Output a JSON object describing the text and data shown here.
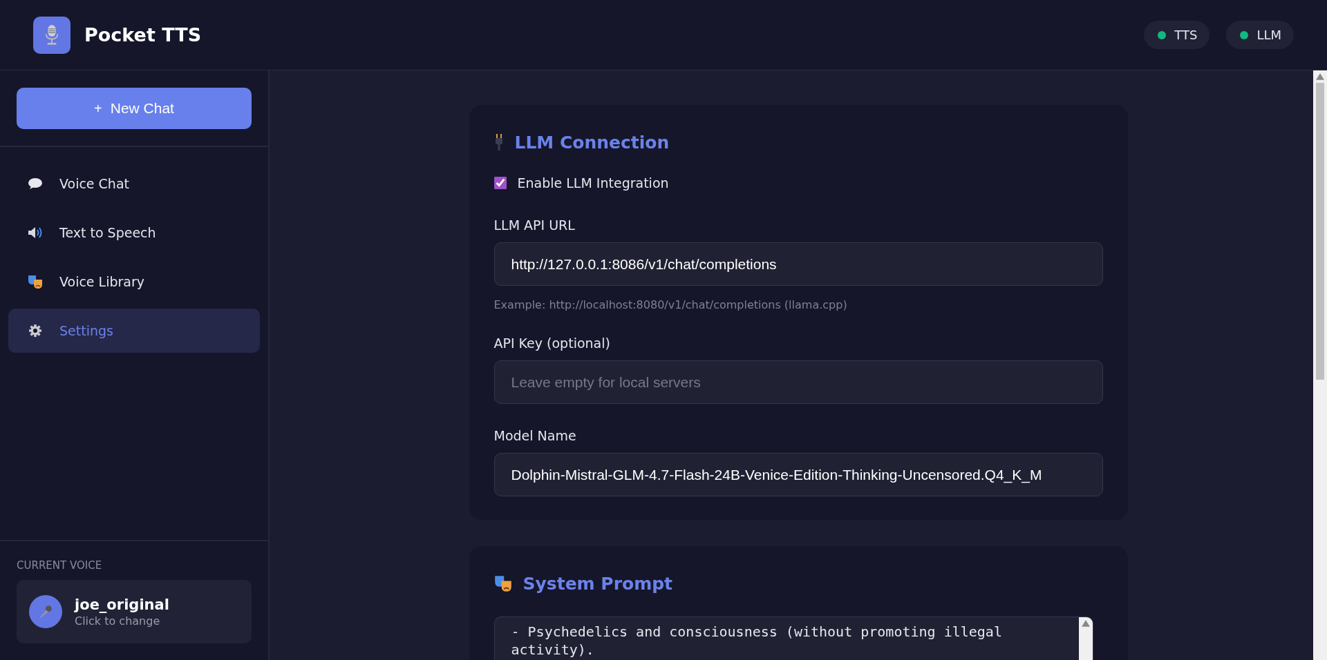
{
  "header": {
    "title": "Pocket TTS",
    "status": [
      {
        "label": "TTS",
        "color": "#10b981"
      },
      {
        "label": "LLM",
        "color": "#10b981"
      }
    ]
  },
  "sidebar": {
    "new_chat": {
      "icon": "+",
      "label": "New Chat"
    },
    "items": [
      {
        "kind": "chat",
        "label": "Voice Chat",
        "selected": false
      },
      {
        "kind": "speaker",
        "label": "Text to Speech",
        "selected": false
      },
      {
        "kind": "masks",
        "label": "Voice Library",
        "selected": false
      },
      {
        "kind": "gear",
        "label": "Settings",
        "selected": true
      }
    ],
    "current_voice": {
      "heading": "CURRENT VOICE",
      "name": "joe_original",
      "hint": "Click to change"
    }
  },
  "sections": [
    {
      "kind": "plug",
      "title": "LLM Connection",
      "fields": [
        {
          "kind": "checkbox",
          "label": "Enable LLM Integration",
          "checked": true
        },
        {
          "kind": "input",
          "label": "LLM API URL",
          "value": "http://127.0.0.1:8086/v1/chat/completions",
          "help": "Example: http://localhost:8080/v1/chat/completions (llama.cpp)"
        },
        {
          "kind": "input",
          "label": "API Key (optional)",
          "placeholder": "Leave empty for local servers"
        },
        {
          "kind": "input",
          "label": "Model Name",
          "value": "Dolphin-Mistral-GLM-4.7-Flash-24B-Venice-Edition-Thinking-Uncensored.Q4_K_M"
        }
      ]
    },
    {
      "kind": "masks",
      "title": "System Prompt",
      "fields": [
        {
          "kind": "textarea",
          "value": "- Psychedelics and consciousness (without promoting illegal\nactivity)."
        }
      ]
    }
  ]
}
